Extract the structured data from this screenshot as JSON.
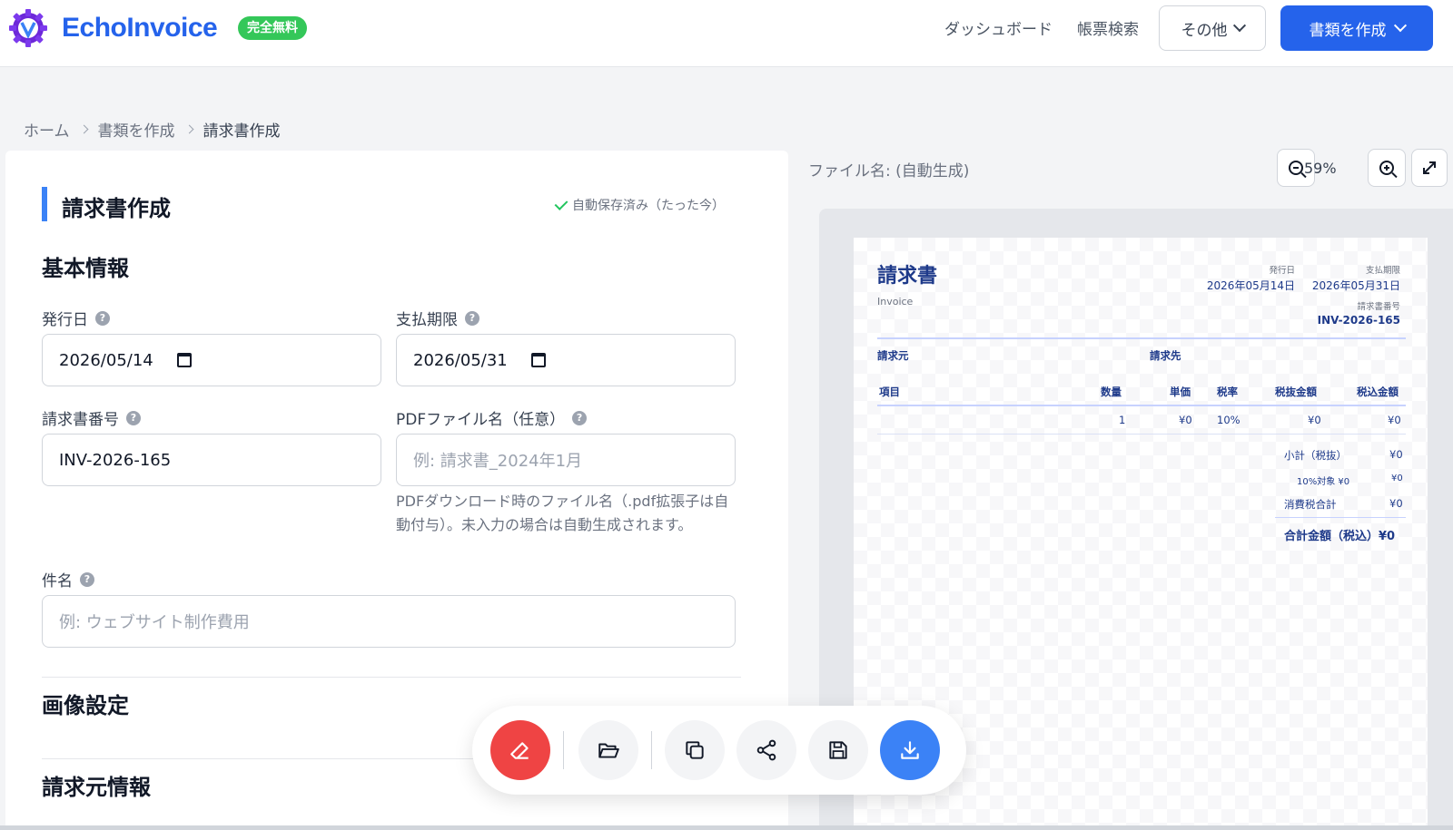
{
  "header": {
    "brand": "EchoInvoice",
    "badge": "完全無料",
    "nav": [
      "ダッシュボード",
      "帳票検索"
    ],
    "other_label": "その他",
    "create_label": "書類を作成"
  },
  "breadcrumb": [
    "ホーム",
    "書類を作成",
    "請求書作成"
  ],
  "form": {
    "title": "請求書作成",
    "autosave": "自動保存済み（たった今）",
    "basic_section": "基本情報",
    "issue_date_label": "発行日",
    "issue_date_value": "2026/05/14",
    "due_date_label": "支払期限",
    "due_date_value": "2026/05/31",
    "invoice_no_label": "請求書番号",
    "invoice_no_value": "INV-2026-165",
    "pdf_name_label": "PDFファイル名（任意）",
    "pdf_name_placeholder": "例: 請求書_2024年1月",
    "pdf_hint": "PDFダウンロード時のファイル名（.pdf拡張子は自動付与）。未入力の場合は自動生成されます。",
    "subject_label": "件名",
    "subject_placeholder": "例: ウェブサイト制作費用",
    "image_section": "画像設定",
    "issuer_section": "請求元情報"
  },
  "preview": {
    "file_name": "ファイル名: (自動生成)",
    "zoom": "59%",
    "doc": {
      "title": "請求書",
      "subtitle": "Invoice",
      "issue_label": "発行日",
      "issue_value": "2026年05月14日",
      "due_label": "支払期限",
      "due_value": "2026年05月31日",
      "number_label": "請求書番号",
      "number_value": "INV-2026-165",
      "from_label": "請求元",
      "to_label": "請求先",
      "columns": [
        "項目",
        "数量",
        "単価",
        "税率",
        "税抜金額",
        "税込金額"
      ],
      "row": [
        "",
        "1",
        "¥0",
        "10%",
        "¥0",
        "¥0"
      ],
      "subtotal_label": "小計（税抜）",
      "subtotal_value": "¥0",
      "taxable_label": "10%対象 ¥0",
      "taxable_value": "¥0",
      "tax_total_label": "消費税合計",
      "tax_total_value": "¥0",
      "grand_total": "合計金額（税込）¥0"
    }
  },
  "colors": {
    "primary": "#2563eb",
    "badge_green": "#34c759",
    "danger": "#ef4444",
    "doc_navy": "#1e3a8a"
  },
  "toolbar_icons": [
    "eraser-icon",
    "folder-open-icon",
    "copy-icon",
    "share-icon",
    "save-icon",
    "download-icon"
  ]
}
